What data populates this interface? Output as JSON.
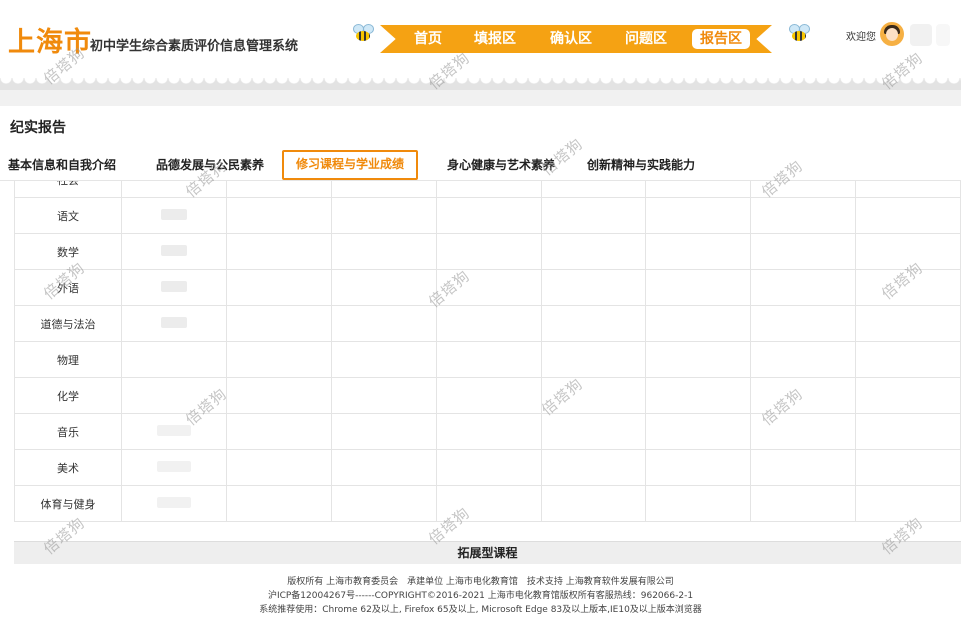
{
  "header": {
    "logo_main": "上海市",
    "logo_sub": "初中学生综合素质评价信息管理系统",
    "nav": [
      {
        "label": "首页"
      },
      {
        "label": "填报区"
      },
      {
        "label": "确认区"
      },
      {
        "label": "问题区"
      },
      {
        "label": "报告区",
        "active": true
      }
    ],
    "welcome": "欢迎您",
    "accent_color": "#f08a0c",
    "nav_color": "#f5a213"
  },
  "section_title": "纪实报告",
  "tabs": [
    {
      "label": "基本信息和自我介绍"
    },
    {
      "label": "品德发展与公民素养"
    },
    {
      "label": "修习课程与学业成绩",
      "active": true
    },
    {
      "label": "身心健康与艺术素养"
    },
    {
      "label": "创新精神与实践能力"
    }
  ],
  "subjects": [
    {
      "name": "社会"
    },
    {
      "name": "语文"
    },
    {
      "name": "数学"
    },
    {
      "name": "外语"
    },
    {
      "name": "道德与法治"
    },
    {
      "name": "物理"
    },
    {
      "name": "化学"
    },
    {
      "name": "音乐"
    },
    {
      "name": "美术"
    },
    {
      "name": "体育与健身"
    }
  ],
  "extension_band": "拓展型课程",
  "footer": {
    "line1": "版权所有 上海市教育委员会　承建单位 上海市电化教育馆　技术支持 上海教育软件发展有限公司",
    "line2": "沪ICP备12004267号------COPYRIGHT©2016-2021 上海市电化教育馆版权所有客服热线：962066-2-1",
    "line3": "系统推荐使用：Chrome 62及以上, Firefox 65及以上, Microsoft Edge 83及以上版本,IE10及以上版本浏览器"
  },
  "watermark": "倍塔狗"
}
